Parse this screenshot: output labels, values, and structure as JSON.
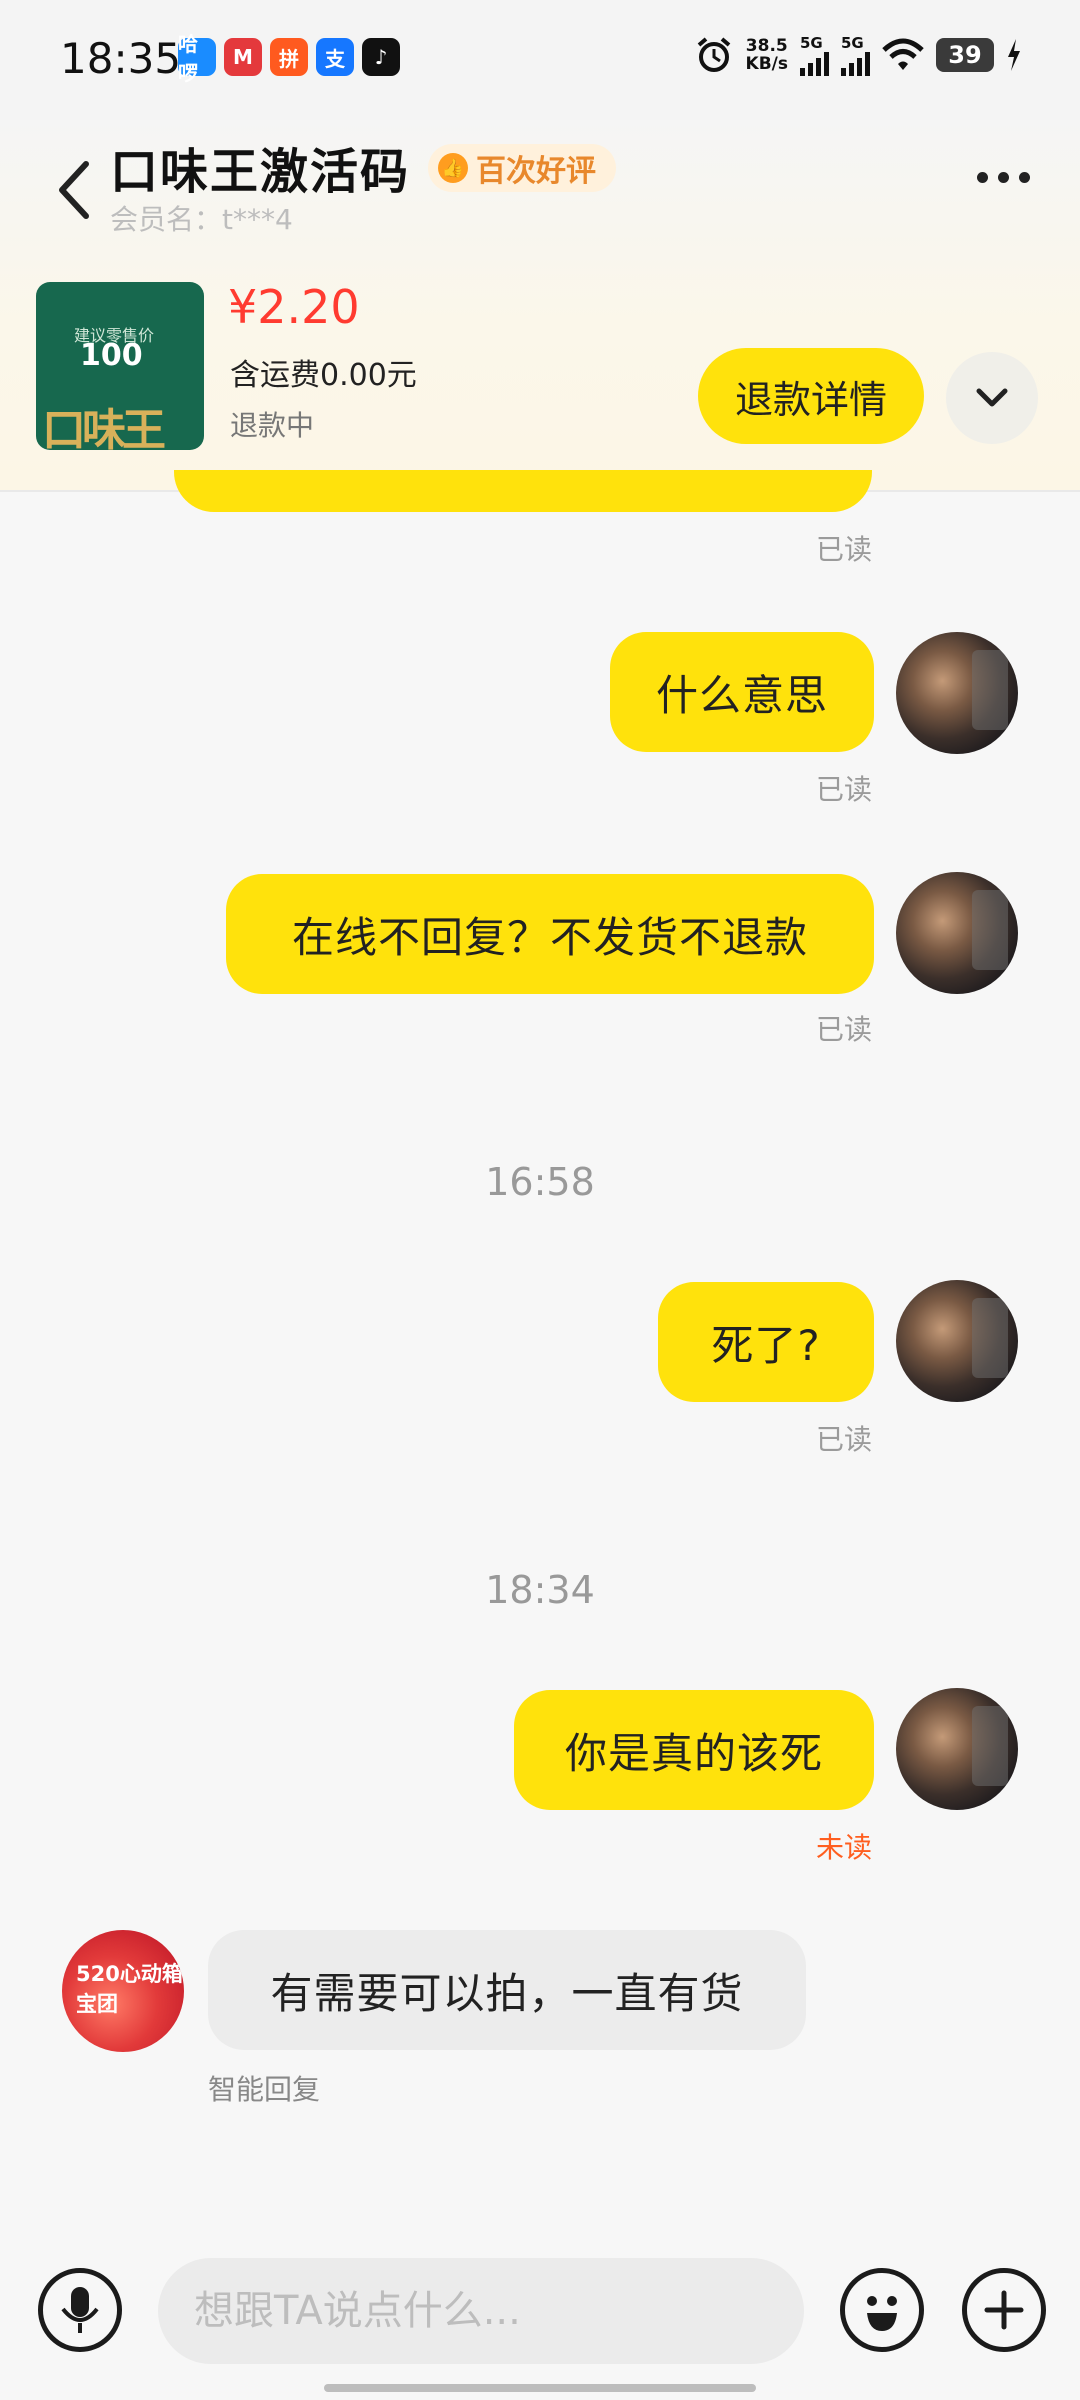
{
  "status_bar": {
    "time": "18:35",
    "apps": [
      {
        "name": "hello-app-icon",
        "label": "哈啰",
        "color": "#1a8cff"
      },
      {
        "name": "metro-app-icon",
        "label": "M",
        "color": "#e4393c"
      },
      {
        "name": "pinduoduo-app-icon",
        "label": "拼",
        "color": "#ff5a1f"
      },
      {
        "name": "alipay-app-icon",
        "label": "支",
        "color": "#1677ff"
      },
      {
        "name": "tiktok-app-icon",
        "label": "♪",
        "color": "#111111"
      }
    ],
    "speed_value": "38.5",
    "speed_unit": "KB/s",
    "net1": "5G",
    "net2": "5G",
    "battery": "39"
  },
  "header": {
    "title": "口味王激活码",
    "badge": "百次好评",
    "member_label": "会员名：t***4"
  },
  "product": {
    "image_small_text": "建议零售价",
    "image_value": "100",
    "image_logo": "口味王",
    "price": "¥2.20",
    "shipping": "含运费0.00元",
    "status": "退款中",
    "refund_button": "退款详情"
  },
  "messages": [
    {
      "side": "out",
      "text": "",
      "receipt": "已读"
    },
    {
      "side": "out",
      "text": "什么意思",
      "receipt": "已读"
    },
    {
      "side": "out",
      "text": "在线不回复？不发货不退款",
      "receipt": "已读"
    },
    {
      "side": "out",
      "text": "死了?",
      "receipt": "已读"
    },
    {
      "side": "out",
      "text": "你是真的该死",
      "receipt": "未读"
    },
    {
      "side": "in",
      "text": "有需要可以拍，一直有货",
      "receipt": "智能回复"
    }
  ],
  "timestamps": [
    "16:58",
    "18:34"
  ],
  "shop_avatar_text": "520心动箱宝团",
  "input": {
    "placeholder": "想跟TA说点什么..."
  },
  "colors": {
    "accent_yellow": "#ffe20c",
    "price_red": "#ff3b30",
    "unread_orange": "#ff5e1f",
    "badge_orange": "#e8882c"
  }
}
